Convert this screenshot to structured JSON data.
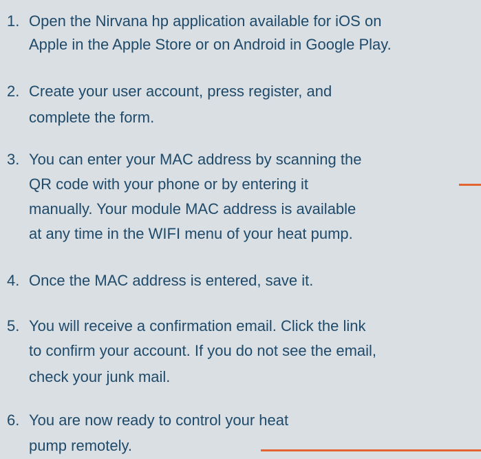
{
  "steps": [
    {
      "number": "1.",
      "lines": [
        "Open the Nirvana hp application available for iOS on",
        "Apple in the Apple Store or on Android in Google Play."
      ]
    },
    {
      "number": "2.",
      "lines": [
        "Create your user account, press register, and",
        "complete the form."
      ]
    },
    {
      "number": "3.",
      "lines": [
        "You can enter your MAC address by scanning the",
        "QR code with your phone or by entering it",
        "manually. Your module MAC address is available",
        "at any time in the WIFI menu of your heat pump."
      ]
    },
    {
      "number": "4.",
      "lines": [
        "Once the MAC address is entered, save it."
      ]
    },
    {
      "number": "5.",
      "lines": [
        "You will receive a confirmation email. Click the link",
        "to confirm your account. If you do not see the email,",
        "check your junk mail."
      ]
    },
    {
      "number": "6.",
      "lines": [
        "You are now ready to control your heat",
        "pump remotely."
      ]
    }
  ],
  "colors": {
    "background": "#d9dfe3",
    "text": "#1f4a6a",
    "accent": "#e4642f"
  }
}
